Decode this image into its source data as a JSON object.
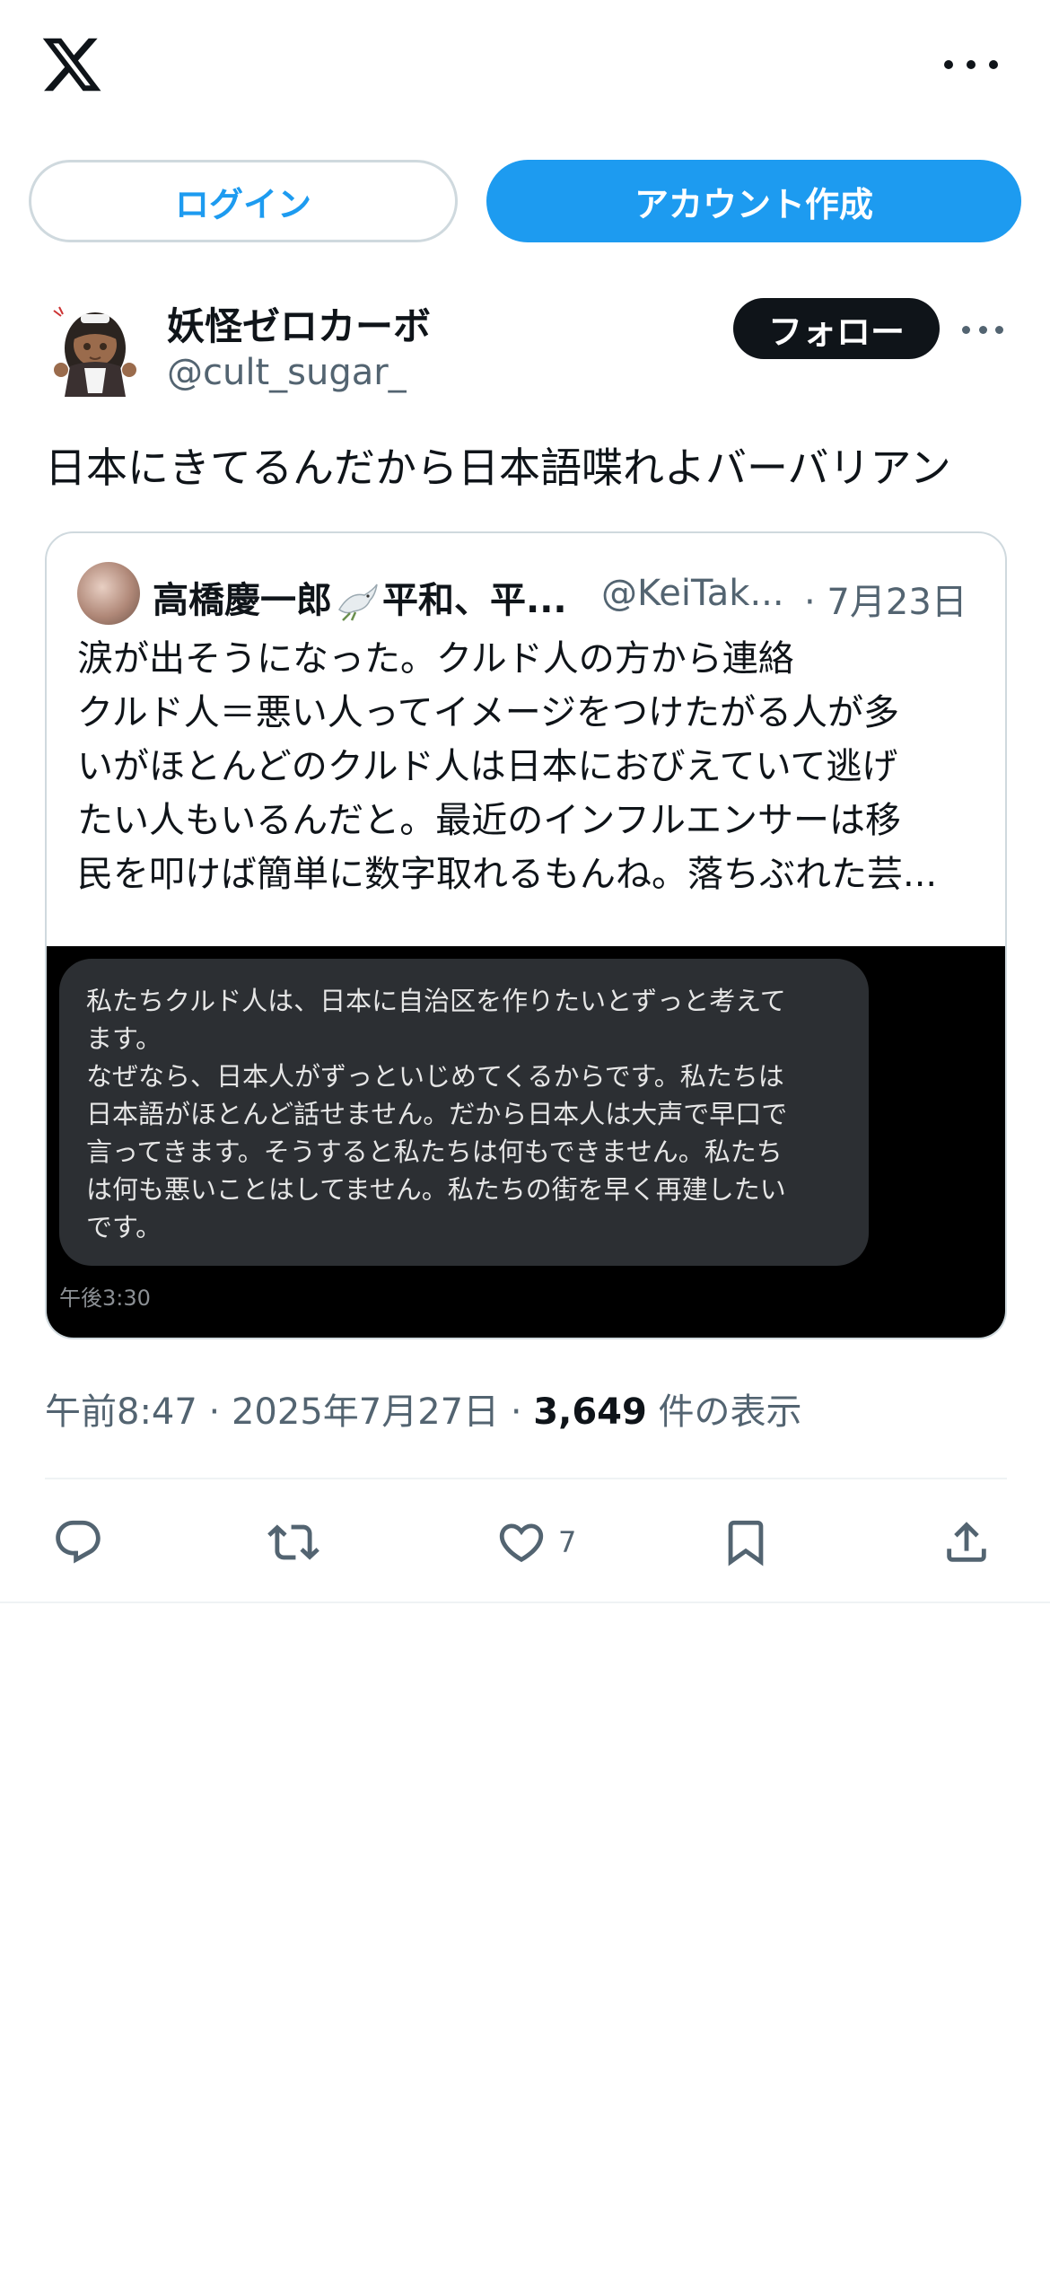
{
  "header": {
    "logo_icon": "x-logo-icon",
    "more_icon": "more-horizontal-icon"
  },
  "auth": {
    "login_label": "ログイン",
    "signup_label": "アカウント作成"
  },
  "author": {
    "display_name": "妖怪ゼロカーボ",
    "handle": "@cult_sugar_",
    "follow_label": "フォロー",
    "avatar_icon": "anime-girl-avatar"
  },
  "tweet": {
    "text": "日本にきてるんだから日本語喋れよバーバリアン"
  },
  "quote": {
    "name_before_emoji": "高橋慶一郎",
    "emoji_icon": "dove-icon",
    "name_after_emoji": "平和、平...",
    "handle": "@KeiTak...",
    "date": "· 7月23日",
    "body_lines": [
      "涙が出そうになった。クルド人の方から連絡",
      "クルド人＝悪い人ってイメージをつけたがる人が多",
      "いがほとんどのクルド人は日本におびえていて逃げ",
      "たい人もいるんだと。最近のインフルエンサーは移",
      "民を叩けば簡単に数字取れるもんね。落ちぶれた芸..."
    ],
    "media": {
      "bubble_lines": [
        "私たちクルド人は、日本に自治区を作りたいとずっと考えて",
        "ます。",
        "なぜなら、日本人がずっといじめてくるからです。私たちは",
        "日本語がほとんど話せません。だから日本人は大声で早口で",
        "言ってきます。そうすると私たちは何もできません。私たち",
        "は何も悪いことはしてません。私たちの街を早く再建したい",
        "です。"
      ],
      "time": "午後3:30"
    }
  },
  "meta": {
    "time": "午前8:47",
    "separator": "·",
    "date": "2025年7月27日",
    "views_count": "3,649",
    "views_label": "件の表示"
  },
  "actions": {
    "reply_icon": "reply-icon",
    "retweet_icon": "retweet-icon",
    "like_icon": "heart-icon",
    "like_count": "7",
    "bookmark_icon": "bookmark-icon",
    "share_icon": "share-icon"
  },
  "colors": {
    "accent": "#1d9bf0",
    "text": "#0f1419",
    "muted": "#536471",
    "border": "#cfd9de",
    "media_bg": "#000000",
    "bubble_bg": "#2c2f33"
  }
}
